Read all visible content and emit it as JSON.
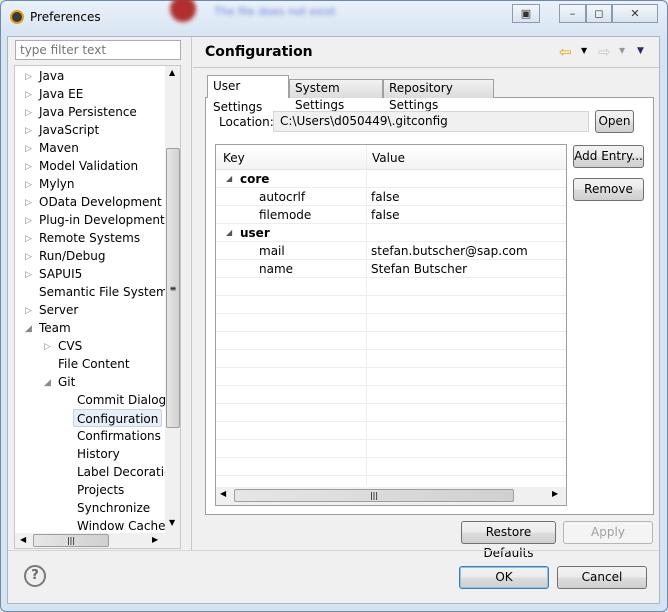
{
  "window": {
    "title": "Preferences",
    "background_notification": "The file does not exist"
  },
  "filter": {
    "placeholder": "type filter text"
  },
  "tree": {
    "items": [
      {
        "label": "Java",
        "level": 0,
        "arrow": "collapsed"
      },
      {
        "label": "Java EE",
        "level": 0,
        "arrow": "collapsed"
      },
      {
        "label": "Java Persistence",
        "level": 0,
        "arrow": "collapsed"
      },
      {
        "label": "JavaScript",
        "level": 0,
        "arrow": "collapsed"
      },
      {
        "label": "Maven",
        "level": 0,
        "arrow": "collapsed"
      },
      {
        "label": "Model Validation",
        "level": 0,
        "arrow": "collapsed"
      },
      {
        "label": "Mylyn",
        "level": 0,
        "arrow": "collapsed"
      },
      {
        "label": "OData Development",
        "level": 0,
        "arrow": "collapsed"
      },
      {
        "label": "Plug-in Development",
        "level": 0,
        "arrow": "collapsed"
      },
      {
        "label": "Remote Systems",
        "level": 0,
        "arrow": "collapsed"
      },
      {
        "label": "Run/Debug",
        "level": 0,
        "arrow": "collapsed"
      },
      {
        "label": "SAPUI5",
        "level": 0,
        "arrow": "collapsed"
      },
      {
        "label": "Semantic File System",
        "level": 0,
        "arrow": "none"
      },
      {
        "label": "Server",
        "level": 0,
        "arrow": "collapsed"
      },
      {
        "label": "Team",
        "level": 0,
        "arrow": "expanded"
      },
      {
        "label": "CVS",
        "level": 1,
        "arrow": "collapsed"
      },
      {
        "label": "File Content",
        "level": 1,
        "arrow": "none"
      },
      {
        "label": "Git",
        "level": 1,
        "arrow": "expanded"
      },
      {
        "label": "Commit Dialog",
        "level": 2,
        "arrow": "none"
      },
      {
        "label": "Configuration",
        "level": 2,
        "arrow": "none",
        "selected": true
      },
      {
        "label": "Confirmations and Warnings",
        "level": 2,
        "arrow": "none"
      },
      {
        "label": "History",
        "level": 2,
        "arrow": "none"
      },
      {
        "label": "Label Decorations",
        "level": 2,
        "arrow": "none"
      },
      {
        "label": "Projects",
        "level": 2,
        "arrow": "none"
      },
      {
        "label": "Synchronize",
        "level": 2,
        "arrow": "none"
      },
      {
        "label": "Window Cache",
        "level": 2,
        "arrow": "none"
      }
    ]
  },
  "page": {
    "title": "Configuration"
  },
  "tabs": [
    {
      "label": "User Settings",
      "active": true
    },
    {
      "label": "System Settings"
    },
    {
      "label": "Repository Settings"
    }
  ],
  "location": {
    "label": "Location:",
    "value": "C:\\Users\\d050449\\.gitconfig",
    "open_label": "Open"
  },
  "table": {
    "columns": [
      "Key",
      "Value"
    ],
    "rows": [
      {
        "key": "core",
        "value": "",
        "section": true
      },
      {
        "key": "autocrlf",
        "value": "false"
      },
      {
        "key": "filemode",
        "value": "false"
      },
      {
        "key": "user",
        "value": "",
        "section": true
      },
      {
        "key": "mail",
        "value": "stefan.butscher@sap.com"
      },
      {
        "key": "name",
        "value": "Stefan Butscher"
      }
    ]
  },
  "buttons": {
    "add_entry": "Add Entry...",
    "remove": "Remove",
    "restore_defaults": "Restore Defaults",
    "apply": "Apply",
    "ok": "OK",
    "cancel": "Cancel"
  },
  "colors": {
    "accent": "#3c7fb1",
    "nav_back": "#e8a000"
  }
}
